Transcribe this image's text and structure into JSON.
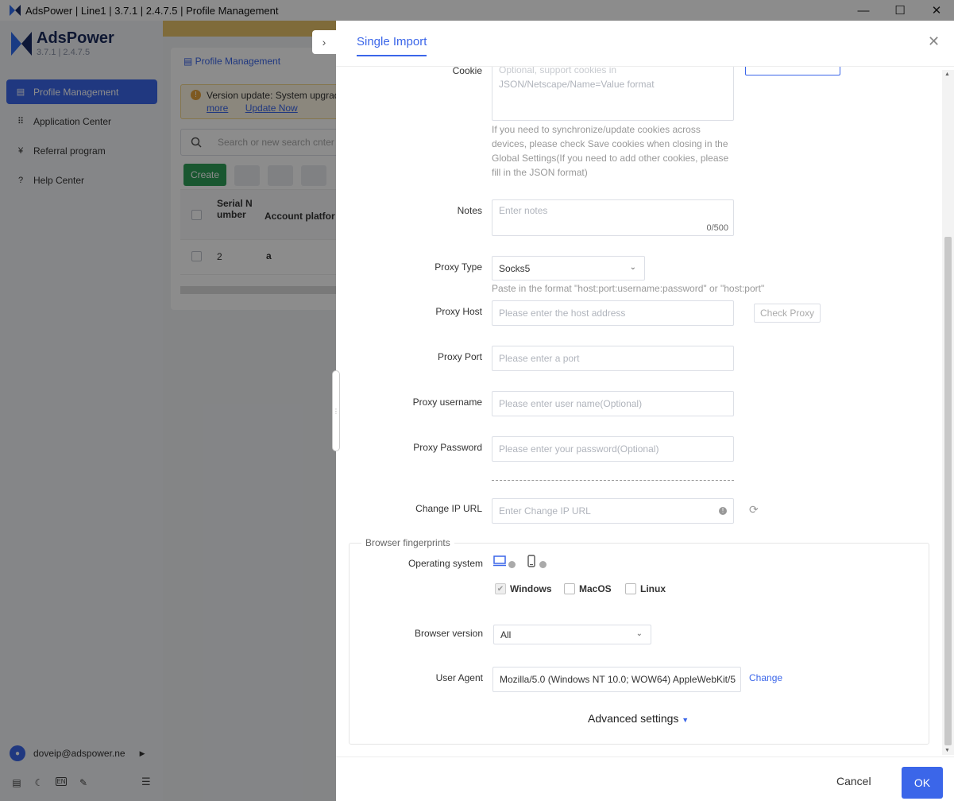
{
  "window": {
    "title": "AdsPower | Line1 | 3.7.1 | 2.4.7.5 | Profile Management",
    "minimize": "—",
    "maximize": "☐",
    "close": "✕"
  },
  "sidebar": {
    "brand": "AdsPower",
    "version": "3.7.1 | 2.4.7.5",
    "items": [
      {
        "label": "Profile Management",
        "active": true,
        "icon": "profile-icon"
      },
      {
        "label": "Application Center",
        "active": false,
        "icon": "grid-icon"
      },
      {
        "label": "Referral program",
        "active": false,
        "icon": "gift-icon"
      },
      {
        "label": "Help Center",
        "active": false,
        "icon": "help-icon"
      }
    ],
    "user_email": "doveip@adspower.ne",
    "lang_badge": "EN"
  },
  "background": {
    "page_title": "Profile Management",
    "notice_text": "Version update: System upgrad",
    "notice_more": "more",
    "notice_update": "Update Now",
    "search_placeholder": "Search or new search cnter",
    "create_label": "Create",
    "columns": [
      "Serial N umber",
      "Account platfor"
    ],
    "row_serial": "2",
    "row_platform_icon": "a"
  },
  "drawer": {
    "tab_label": "Single Import",
    "close_icon": "✕",
    "collapse_icon": "›",
    "cookie_label": "Cookie",
    "cookie_placeholder_line1": "Optional, support cookies in",
    "cookie_placeholder_line2": "JSON/Netscape/Name=Value format",
    "cookie_hint": "If you need to synchronize/update cookies across devices, please check Save cookies when closing in the Global Settings(If you need to add other cookies, please fill in the JSON format)",
    "notes_label": "Notes",
    "notes_placeholder": "Enter notes",
    "notes_counter": "0/500",
    "proxy_type_label": "Proxy Type",
    "proxy_type_value": "Socks5",
    "proxy_format_hint": "Paste in the format \"host:port:username:password\" or \"host:port\"",
    "proxy_host_label": "Proxy Host",
    "proxy_host_placeholder": "Please enter the host address",
    "check_proxy_label": "Check Proxy",
    "proxy_port_label": "Proxy Port",
    "proxy_port_placeholder": "Please enter a port",
    "proxy_user_label": "Proxy username",
    "proxy_user_placeholder": "Please enter user name(Optional)",
    "proxy_pass_label": "Proxy Password",
    "proxy_pass_placeholder": "Please enter your password(Optional)",
    "change_ip_label": "Change IP URL",
    "change_ip_placeholder": "Enter Change IP URL",
    "fingerprint_section": "Browser fingerprints",
    "os_label": "Operating system",
    "os_options": [
      {
        "label": "Windows",
        "checked": true
      },
      {
        "label": "MacOS",
        "checked": false
      },
      {
        "label": "Linux",
        "checked": false
      }
    ],
    "browser_version_label": "Browser version",
    "browser_version_value": "All",
    "user_agent_label": "User Agent",
    "user_agent_value": "Mozilla/5.0 (Windows NT 10.0; WOW64) AppleWebKit/5",
    "change_label": "Change",
    "advanced_label": "Advanced settings",
    "cancel_label": "Cancel",
    "ok_label": "OK"
  },
  "colors": {
    "accent": "#3b66e9",
    "create_green": "#2f9e58",
    "notice_bg": "#fdf6e4"
  }
}
